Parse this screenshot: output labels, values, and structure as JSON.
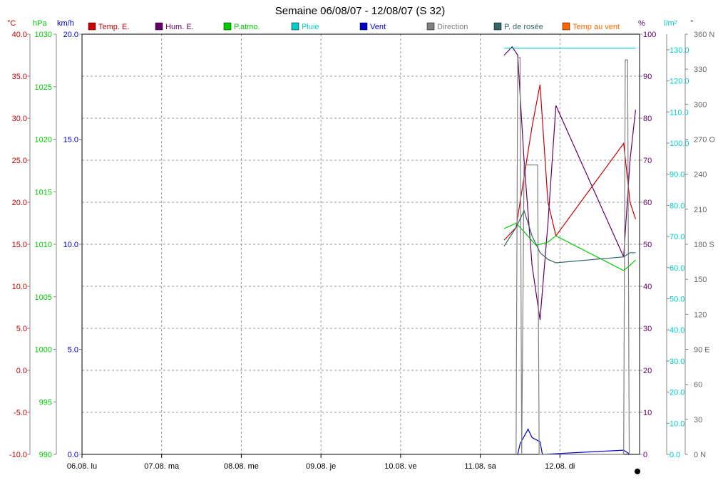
{
  "chart_data": {
    "type": "line",
    "title": "Semaine 06/08/07 - 12/08/07 (S 32)",
    "x_tick_labels": [
      "06.08.  lu",
      "07.08.  ma",
      "08.08.  me",
      "09.08.  je",
      "10.08.  ve",
      "11.08.  sa",
      "12.08.  di"
    ],
    "xlim": [
      0,
      7
    ],
    "grid": true,
    "legend_position": "top",
    "legend": [
      {
        "label": "Temp. E.",
        "color": "#cc0000"
      },
      {
        "label": "Hum. E.",
        "color": "#660066"
      },
      {
        "label": "P.atmo.",
        "color": "#00cc00"
      },
      {
        "label": "Pluie",
        "color": "#00cccc"
      },
      {
        "label": "Vent",
        "color": "#0000cc"
      },
      {
        "label": "Direction",
        "color": "#808080"
      },
      {
        "label": "P. de rosée",
        "color": "#336666"
      },
      {
        "label": "Temp au vent",
        "color": "#ff6600"
      }
    ],
    "axes": {
      "temperature": {
        "unit": "°C",
        "min": -10,
        "max": 40,
        "ticks": [
          "40.0",
          "35.0",
          "30.0",
          "25.0",
          "20.0",
          "15.0",
          "10.0",
          "5.0",
          "0.0",
          "-5.0",
          "-10.0"
        ],
        "color": "#cc0000"
      },
      "pressure": {
        "unit": "hPa",
        "min": 990,
        "max": 1030,
        "ticks": [
          "1030",
          "1025",
          "1020",
          "1015",
          "1010",
          "1005",
          "1000",
          "995",
          "990"
        ],
        "color": "#00cc00"
      },
      "wind": {
        "unit": "km/h",
        "min": 0,
        "max": 20,
        "ticks": [
          "20.0",
          "15.0",
          "10.0",
          "5.0",
          "0.0"
        ],
        "color": "#0000cc"
      },
      "humidity": {
        "unit": "%",
        "min": 0,
        "max": 100,
        "ticks": [
          "100",
          "90",
          "80",
          "70",
          "60",
          "50",
          "40",
          "30",
          "20",
          "10",
          "0"
        ],
        "color": "#660066"
      },
      "rain": {
        "unit": "l/m²",
        "min": 0,
        "max": 135,
        "ticks": [
          "130.0",
          "120.0",
          "110.0",
          "100.0",
          "90.0",
          "80.0",
          "70.0",
          "60.0",
          "50.0",
          "40.0",
          "30.0",
          "20.0",
          "10.0",
          "0.0"
        ],
        "color": "#00cccc"
      },
      "direction": {
        "unit": "°",
        "min": 0,
        "max": 360,
        "ticks": [
          "360 N",
          "330",
          "300",
          "270 O",
          "240",
          "210",
          "180 S",
          "150",
          "120",
          "90 E",
          "60",
          "30",
          "0   N"
        ],
        "color": "#666666"
      }
    },
    "series": [
      {
        "name": "Temp. E.",
        "axis": "temperature",
        "color": "#cc0000",
        "points": [
          [
            5.3,
            15.5
          ],
          [
            5.45,
            17
          ],
          [
            5.55,
            23
          ],
          [
            5.65,
            29
          ],
          [
            5.75,
            34
          ],
          [
            5.85,
            20
          ],
          [
            5.95,
            16
          ],
          [
            6.8,
            27
          ],
          [
            6.88,
            20
          ],
          [
            6.95,
            18
          ]
        ]
      },
      {
        "name": "Hum. E.",
        "axis": "humidity",
        "color": "#660066",
        "points": [
          [
            5.3,
            95
          ],
          [
            5.4,
            97
          ],
          [
            5.47,
            95
          ],
          [
            5.55,
            70
          ],
          [
            5.65,
            45
          ],
          [
            5.75,
            32
          ],
          [
            5.85,
            55
          ],
          [
            5.95,
            83
          ],
          [
            6.8,
            47
          ],
          [
            6.88,
            70
          ],
          [
            6.95,
            82
          ]
        ]
      },
      {
        "name": "P.atmo.",
        "axis": "pressure",
        "color": "#00cc00",
        "points": [
          [
            5.3,
            1011.5
          ],
          [
            5.45,
            1012
          ],
          [
            5.55,
            1011.2
          ],
          [
            5.7,
            1009.9
          ],
          [
            5.85,
            1010.2
          ],
          [
            5.95,
            1010.8
          ],
          [
            6.8,
            1007.5
          ],
          [
            6.88,
            1008
          ],
          [
            6.95,
            1008.5
          ]
        ]
      },
      {
        "name": "Pluie",
        "axis": "rain",
        "color": "#00cccc",
        "points": [
          [
            5.3,
            130.5
          ],
          [
            5.95,
            130.5
          ],
          [
            6.8,
            130.5
          ],
          [
            6.95,
            130.5
          ]
        ]
      },
      {
        "name": "Vent",
        "axis": "wind",
        "color": "#0000cc",
        "points": [
          [
            5.47,
            0
          ],
          [
            5.5,
            0.5
          ],
          [
            5.6,
            1.2
          ],
          [
            5.65,
            0.8
          ],
          [
            5.75,
            0.6
          ],
          [
            5.78,
            0
          ],
          [
            6.8,
            0.2
          ],
          [
            6.88,
            0
          ]
        ]
      },
      {
        "name": "Direction",
        "axis": "direction",
        "color": "#808080",
        "points": [
          [
            5.45,
            0
          ],
          [
            5.47,
            340
          ],
          [
            5.5,
            340
          ],
          [
            5.52,
            0
          ],
          [
            5.55,
            248
          ],
          [
            5.72,
            248
          ],
          [
            5.74,
            0
          ],
          [
            6.8,
            0
          ],
          [
            6.82,
            338
          ],
          [
            6.85,
            338
          ],
          [
            6.87,
            0
          ]
        ]
      },
      {
        "name": "P. de rosée",
        "axis": "temperature",
        "color": "#336666",
        "points": [
          [
            5.3,
            14.8
          ],
          [
            5.45,
            17
          ],
          [
            5.55,
            19
          ],
          [
            5.65,
            16
          ],
          [
            5.75,
            14
          ],
          [
            5.85,
            13.2
          ],
          [
            5.95,
            12.8
          ],
          [
            6.8,
            13.5
          ],
          [
            6.88,
            14
          ],
          [
            6.95,
            14
          ]
        ]
      }
    ]
  }
}
